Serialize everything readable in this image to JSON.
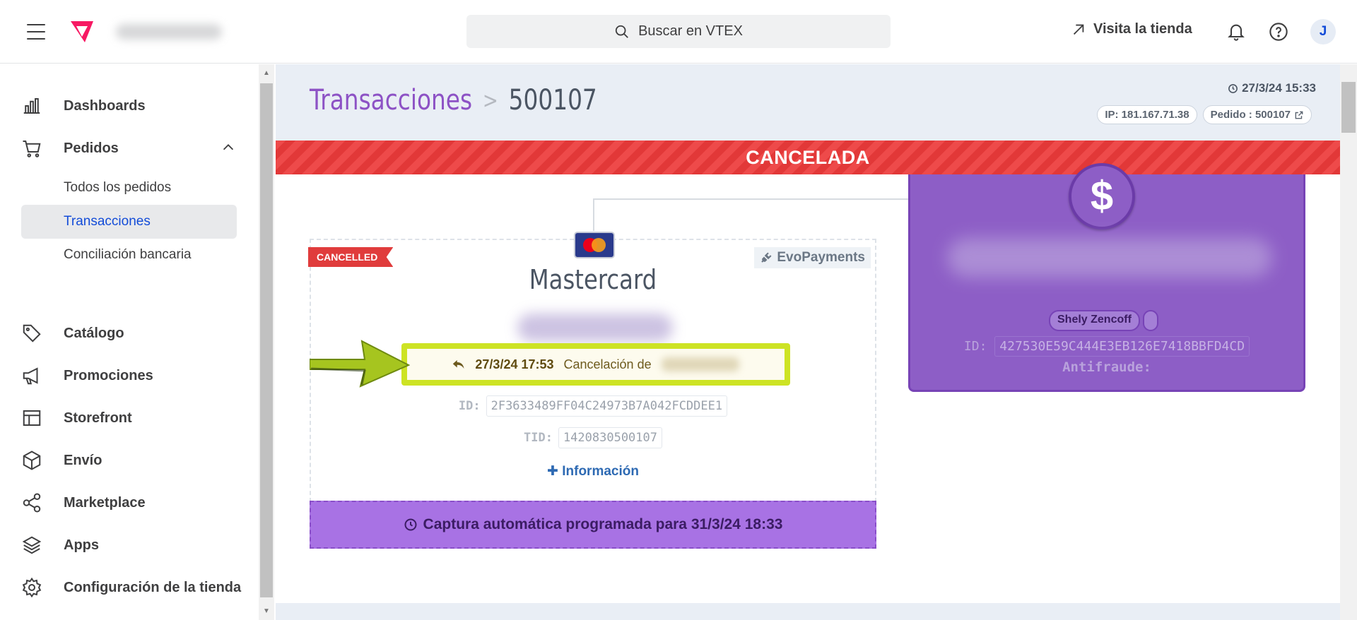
{
  "topbar": {
    "search_placeholder": "Buscar en VTEX",
    "visit_store": "Visita la tienda",
    "avatar_initial": "J"
  },
  "sidebar": {
    "items": [
      {
        "label": "Dashboards",
        "icon": "bar-chart-icon"
      },
      {
        "label": "Pedidos",
        "icon": "cart-icon"
      },
      {
        "label": "Catálogo",
        "icon": "tag-icon"
      },
      {
        "label": "Promociones",
        "icon": "megaphone-icon"
      },
      {
        "label": "Storefront",
        "icon": "layout-icon"
      },
      {
        "label": "Envío",
        "icon": "box-icon"
      },
      {
        "label": "Marketplace",
        "icon": "share-icon"
      },
      {
        "label": "Apps",
        "icon": "layers-icon"
      },
      {
        "label": "Configuración de la tienda",
        "icon": "gear-icon"
      }
    ],
    "pedidos_sub": [
      {
        "label": "Todos los pedidos"
      },
      {
        "label": "Transacciones",
        "active": true
      },
      {
        "label": "Conciliación bancaria"
      }
    ]
  },
  "main": {
    "breadcrumb_root": "Transacciones",
    "breadcrumb_sep": ">",
    "breadcrumb_current": "500107",
    "timestamp": "27/3/24 15:33",
    "ip": "IP: 181.167.71.38",
    "pedido": "Pedido : 500107",
    "status_banner": "CANCELADA",
    "payment": {
      "ribbon": "CANCELLED",
      "method": "Mastercard",
      "connector": "EvoPayments",
      "cancel_time": "27/3/24 17:53",
      "cancel_text": "Cancelación de",
      "id_label": "ID:",
      "id_value": "2F3633489FF04C24973B7A042FCDDEE1",
      "tid_label": "TID:",
      "tid_value": "1420830500107",
      "more_info": "Información",
      "capture": "Captura automática programada para 31/3/24 18:33"
    },
    "order": {
      "symbol": "$",
      "seller": "Shely Zencoff",
      "id_label": "ID:",
      "id_value": "427530E59C444E3EB126E7418BBFD4CD",
      "antifraud_label": "Antifraude:"
    }
  },
  "colors": {
    "brand_pink": "#f71963",
    "accent_purple": "#8d52c5",
    "cancel_red": "#e23838",
    "highlight_lime": "#cde324",
    "capture_purple": "#a872e4",
    "link_blue": "#134cd8"
  }
}
